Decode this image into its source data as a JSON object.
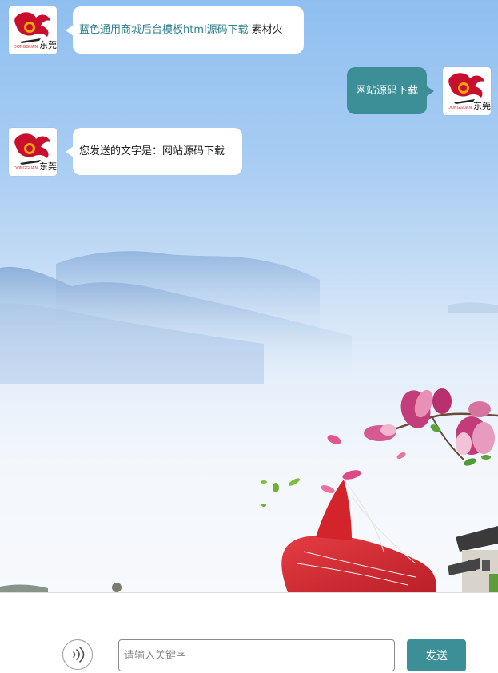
{
  "messages": [
    {
      "side": "bot",
      "link_text": "蓝色通用商城后台模板html源码下载",
      "suffix_text": "素材火"
    },
    {
      "side": "user",
      "text": "网站源码下载"
    },
    {
      "side": "bot",
      "text": "您发送的文字是：网站源码下载"
    }
  ],
  "input_bar": {
    "placeholder": "请输入关键字",
    "send_label": "发送",
    "voice_icon": "voice-wave-icon"
  },
  "colors": {
    "accent": "#3d8f97",
    "link": "#2f7f8c",
    "bubble_bg": "#ffffff"
  }
}
